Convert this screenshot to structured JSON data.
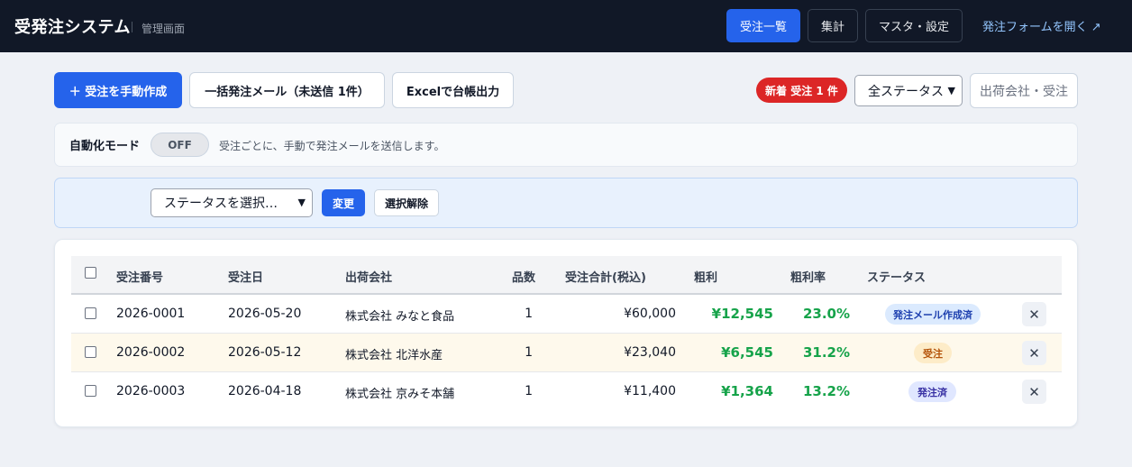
{
  "header": {
    "title": "受発注システム",
    "subtitle": "管理画面",
    "nav": {
      "orders": "受注一覧",
      "summary": "集計",
      "master": "マスタ・設定",
      "form_link": "発注フォームを開く ↗"
    }
  },
  "toolbar": {
    "create": "＋ 受注を手動作成",
    "bulk_mail": "一括発注メール（未送信 1件）",
    "excel": "Excelで台帳出力",
    "new_badge": "新着 受注 1 件",
    "status_filter": "全ステータス",
    "search_placeholder": "出荷会社・受注"
  },
  "automation": {
    "label": "自動化モード",
    "toggle": "OFF",
    "description": "受注ごとに、手動で発注メールを送信します。"
  },
  "bulk": {
    "select_placeholder": "ステータスを選択…",
    "apply": "変更",
    "clear": "選択解除"
  },
  "table": {
    "headers": {
      "order_no": "受注番号",
      "date": "受注日",
      "company": "出荷会社",
      "qty": "品数",
      "total": "受注合計(税込)",
      "profit": "粗利",
      "margin": "粗利率",
      "status": "ステータス"
    },
    "rows": [
      {
        "order_no": "2026-0001",
        "date": "2026-05-20",
        "company": "株式会社 みなと食品",
        "qty": "1",
        "total": "¥60,000",
        "profit": "¥12,545",
        "margin": "23.0%",
        "status": "発注メール作成済"
      },
      {
        "order_no": "2026-0002",
        "date": "2026-05-12",
        "company": "株式会社 北洋水産",
        "qty": "1",
        "total": "¥23,040",
        "profit": "¥6,545",
        "margin": "31.2%",
        "status": "受注"
      },
      {
        "order_no": "2026-0003",
        "date": "2026-04-18",
        "company": "株式会社 京みそ本舗",
        "qty": "1",
        "total": "¥11,400",
        "profit": "¥1,364",
        "margin": "13.2%",
        "status": "発注済"
      }
    ]
  },
  "colors": {
    "header_bg": "#111827",
    "accent": "#2563eb",
    "new_badge": "#dc2626",
    "profit_green": "#16a34a",
    "status_mail_bg": "#dbeafe",
    "status_order_bg": "#fdecc8",
    "status_done_bg": "#e0e7ff"
  },
  "icons": {
    "delete": "close-icon",
    "dropdown": "chevron-down-icon",
    "external": "external-link-icon"
  }
}
